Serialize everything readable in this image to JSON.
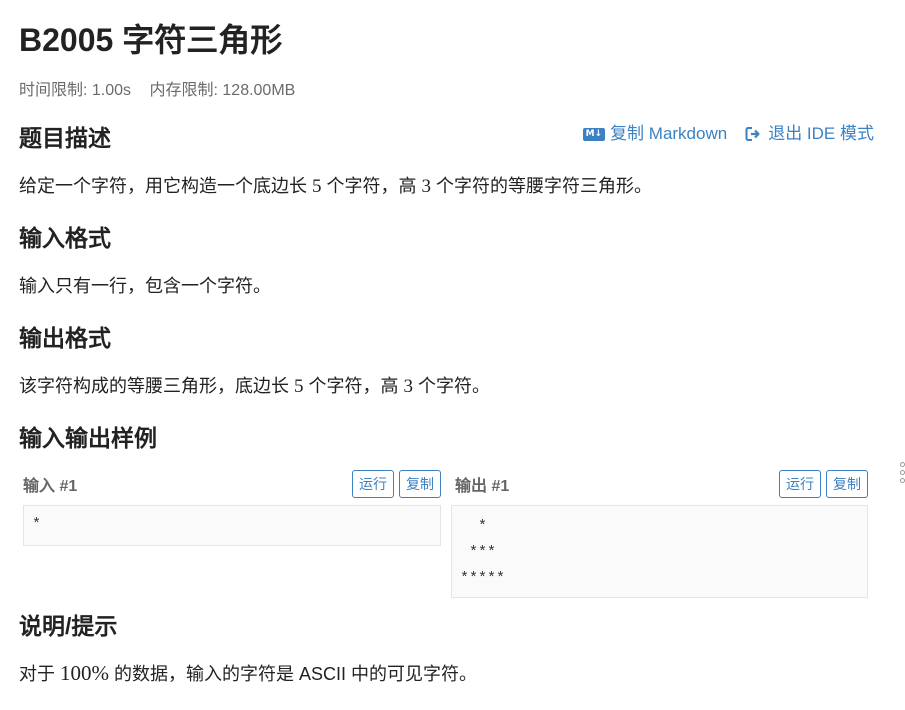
{
  "problem": {
    "title": "B2005 字符三角形",
    "time_limit": "时间限制: 1.00s",
    "memory_limit": "内存限制: 128.00MB"
  },
  "actions": {
    "copy_markdown": "复制 Markdown",
    "md_icon_text": "M↓",
    "exit_ide": "退出 IDE 模式"
  },
  "sections": {
    "description": {
      "heading": "题目描述",
      "parts": [
        "给定一个字符，用它构造一个底边长 ",
        "5",
        " 个字符，高 ",
        "3",
        " 个字符的等腰字符三角形。"
      ]
    },
    "input_format": {
      "heading": "输入格式",
      "text": "输入只有一行，包含一个字符。"
    },
    "output_format": {
      "heading": "输出格式",
      "parts": [
        "该字符构成的等腰三角形，底边长 ",
        "5",
        " 个字符，高 ",
        "3",
        " 个字符。"
      ]
    },
    "samples": {
      "heading": "输入输出样例",
      "input": {
        "label": "输入 #1",
        "run": "运行",
        "copy": "复制",
        "content": "*"
      },
      "output": {
        "label": "输出 #1",
        "run": "运行",
        "copy": "复制",
        "content": "  *\n ***\n*****"
      }
    },
    "hint": {
      "heading": "说明/提示",
      "parts": [
        "对于 ",
        "100%",
        " 的数据，输入的字符是 ASCII 中的可见字符。"
      ]
    }
  },
  "colors": {
    "accent": "#3b82c4",
    "muted": "#6b6b6b"
  }
}
